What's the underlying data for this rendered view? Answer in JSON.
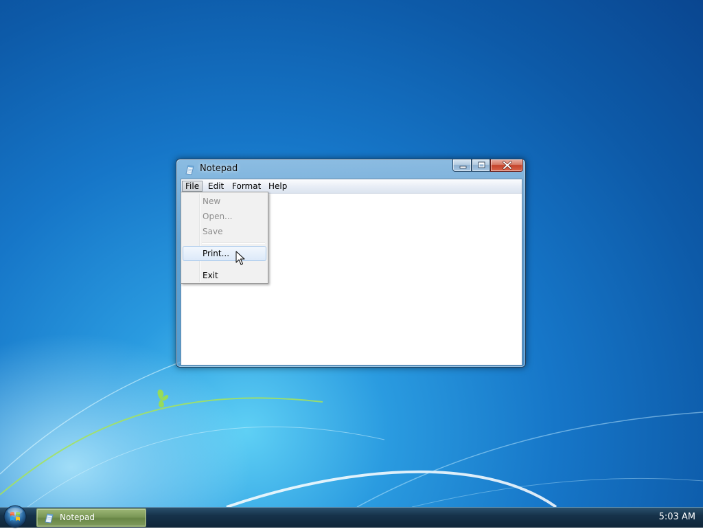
{
  "window": {
    "title": "Notepad"
  },
  "menu_bar": {
    "file": "File",
    "edit": "Edit",
    "format": "Format",
    "help": "Help"
  },
  "file_menu": {
    "items": [
      {
        "label": "New",
        "enabled": false
      },
      {
        "label": "Open...",
        "enabled": false
      },
      {
        "label": "Save",
        "enabled": false
      },
      {
        "label": "Print...",
        "enabled": true,
        "highlighted": true
      },
      {
        "label": "Exit",
        "enabled": true
      }
    ]
  },
  "editor": {
    "text": ""
  },
  "taskbar": {
    "start_icon": "windows-orb-icon",
    "buttons": [
      {
        "label": "Notepad",
        "icon": "notepad-icon",
        "active": true
      }
    ],
    "clock": "5:03 AM"
  },
  "colors": {
    "menu_highlight": "#dce9f9",
    "close_button": "#c4432b",
    "taskbar_active": "#7b9857"
  }
}
